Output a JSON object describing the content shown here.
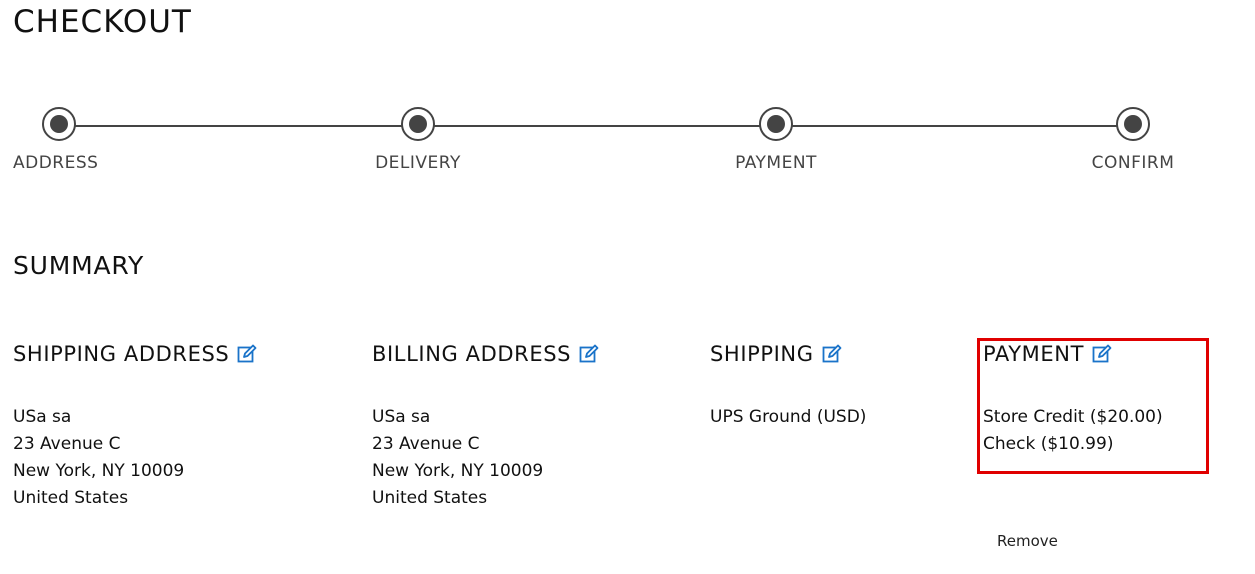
{
  "page": {
    "title": "CHECKOUT"
  },
  "steps": [
    {
      "label": "ADDRESS"
    },
    {
      "label": "DELIVERY"
    },
    {
      "label": "PAYMENT"
    },
    {
      "label": "CONFIRM"
    }
  ],
  "summary": {
    "title": "SUMMARY",
    "shipping_address": {
      "title": "SHIPPING ADDRESS",
      "lines": [
        "USa sa",
        "23 Avenue C",
        "New York, NY 10009",
        "United States"
      ]
    },
    "billing_address": {
      "title": "BILLING ADDRESS",
      "lines": [
        "USa sa",
        "23 Avenue C",
        "New York, NY 10009",
        "United States"
      ]
    },
    "shipping": {
      "title": "SHIPPING",
      "lines": [
        "UPS Ground (USD)"
      ]
    },
    "payment": {
      "title": "PAYMENT",
      "lines": [
        "Store Credit ($20.00)",
        "Check ($10.99)"
      ],
      "remove_label": "Remove"
    }
  },
  "colors": {
    "accent": "#1a73c9",
    "highlight": "#e00000",
    "progress": "#444444"
  },
  "icons": {
    "edit": "edit-icon"
  }
}
